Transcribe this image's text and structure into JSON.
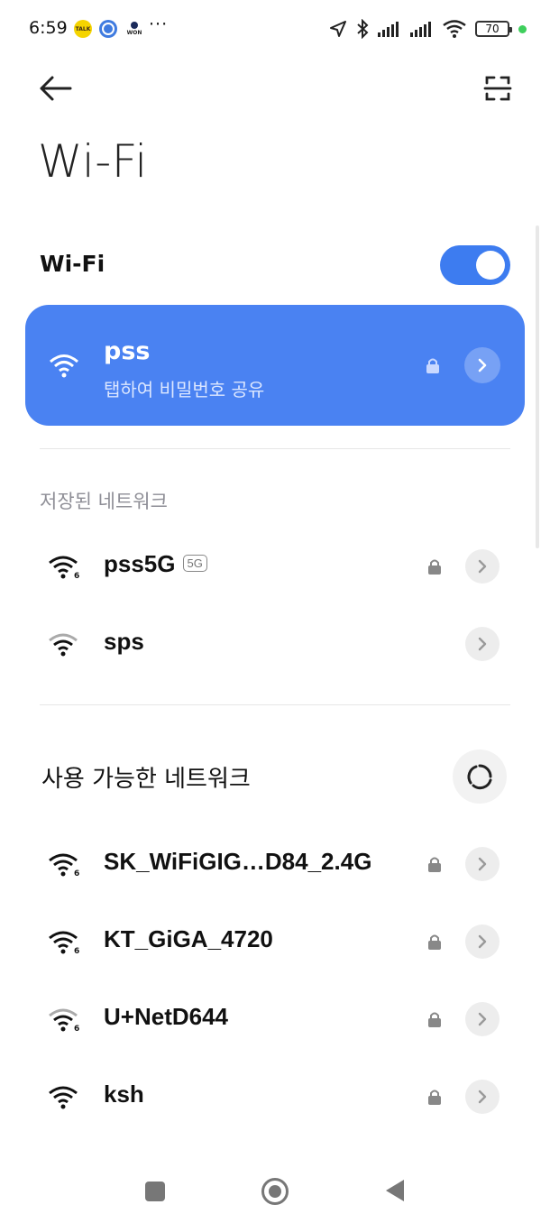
{
  "status_bar": {
    "time": "6:59",
    "app_icons": [
      "kakaotalk-icon",
      "chrome-icon",
      "won-icon"
    ],
    "talk_badge": "TALK",
    "won_badge": "WON",
    "more": "···",
    "battery": "70"
  },
  "page": {
    "title": "Wi-Fi",
    "wifi_toggle_label": "Wi-Fi",
    "wifi_enabled": true
  },
  "connected": {
    "ssid": "pss",
    "subtitle": "탭하여 비밀번호 공유",
    "color": "#4a82f2"
  },
  "saved_networks": {
    "label": "저장된 네트워크",
    "items": [
      {
        "ssid": "pss5G",
        "band": "5G",
        "locked": true
      },
      {
        "ssid": "sps",
        "band": "",
        "locked": false
      }
    ]
  },
  "available_networks": {
    "label": "사용 가능한 네트워크",
    "items": [
      {
        "ssid": "SK_WiFiGIG…D84_2.4G",
        "locked": true
      },
      {
        "ssid": "KT_GiGA_4720",
        "locked": true
      },
      {
        "ssid": "U+NetD644",
        "locked": true
      },
      {
        "ssid": "ksh",
        "locked": true
      }
    ]
  },
  "colors": {
    "accent": "#3d7cf0",
    "text": "#111111",
    "secondary": "#8e8e96"
  }
}
